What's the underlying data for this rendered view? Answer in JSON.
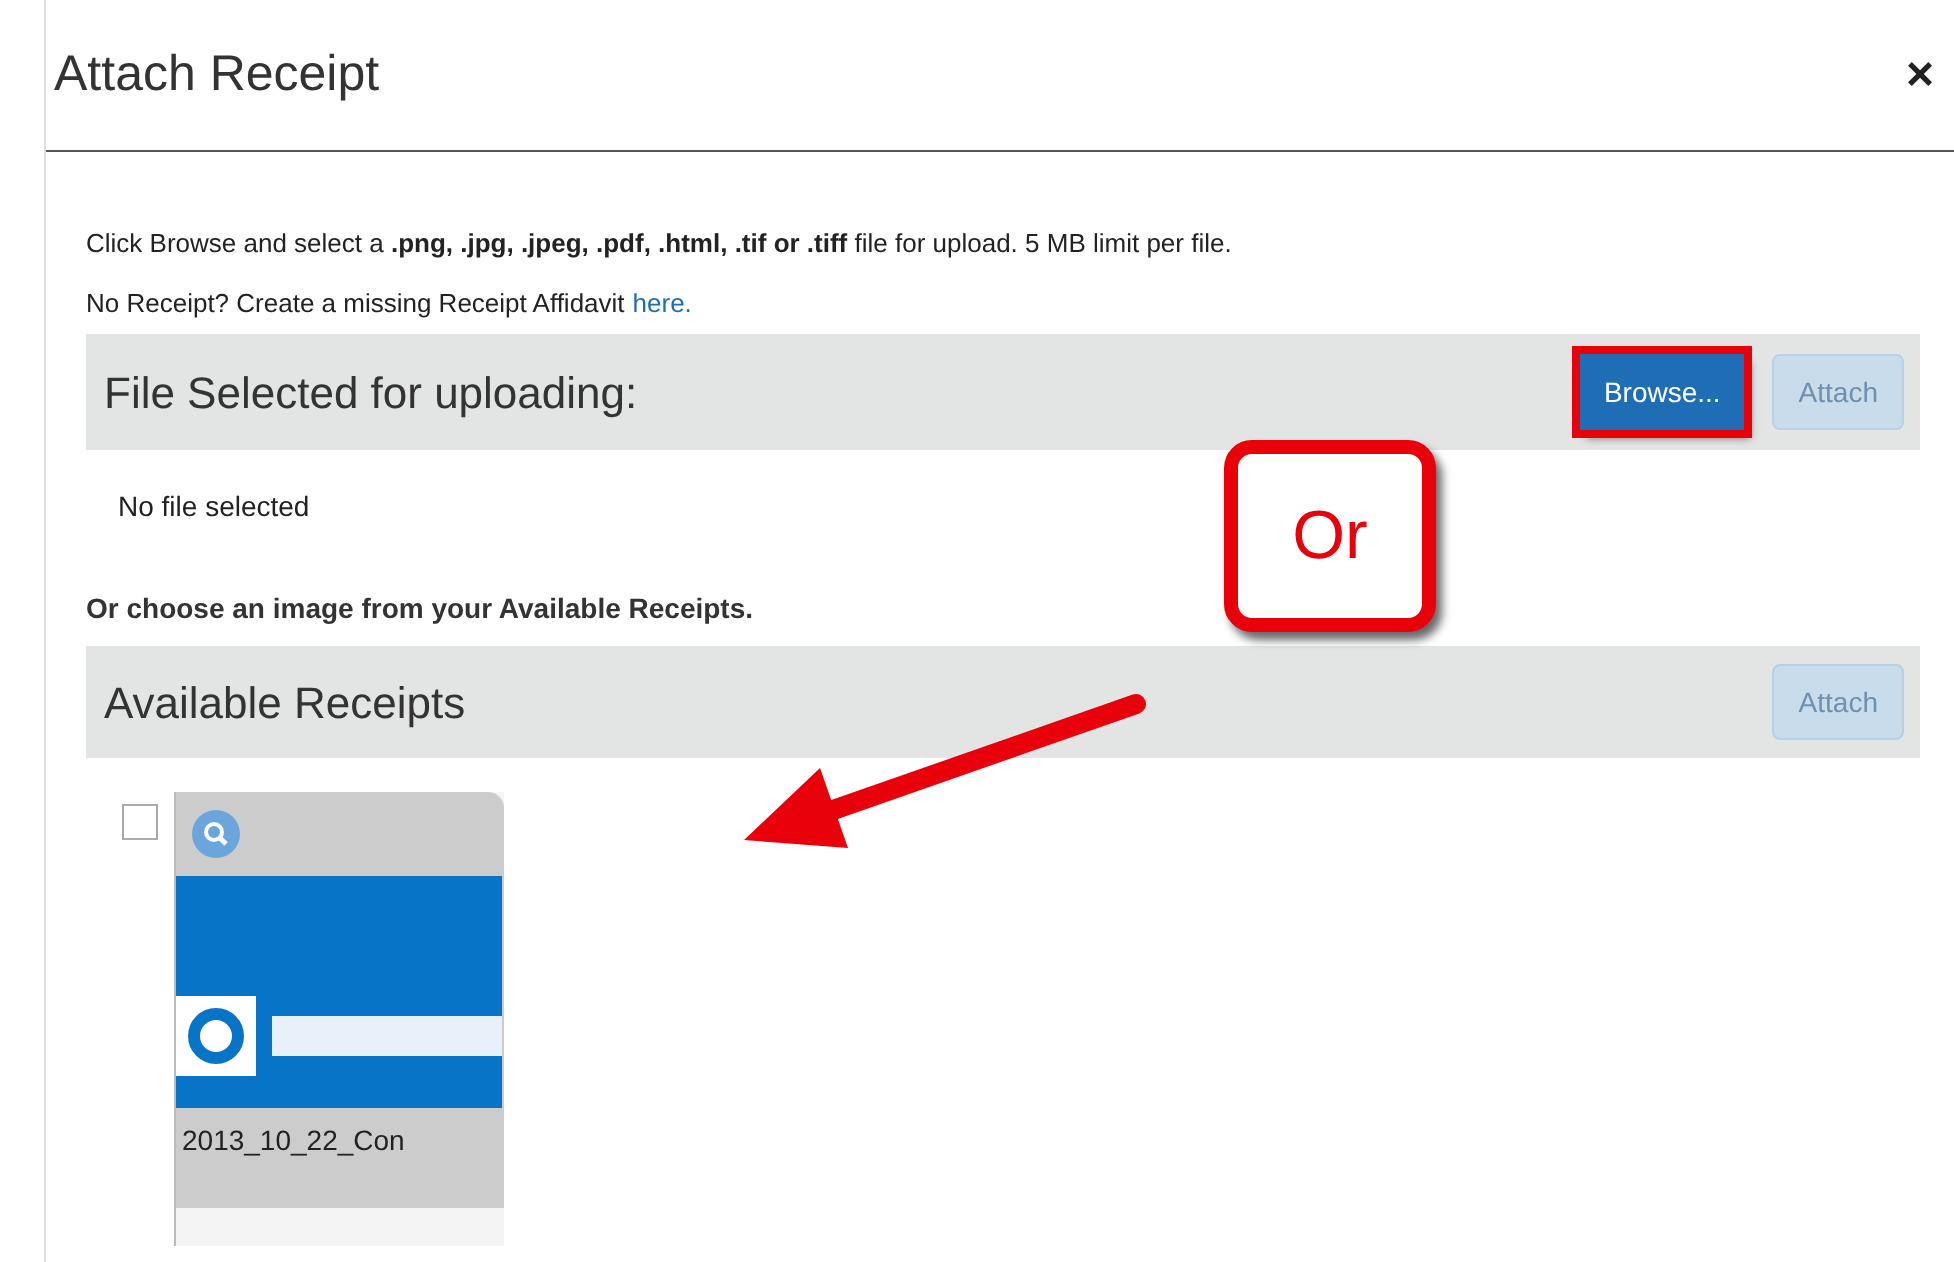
{
  "dialog": {
    "title": "Attach Receipt",
    "close": "×"
  },
  "instructions": "Click Browse and select a **.png, .jpg, .jpeg, .pdf, .html, .tif or .tiff** file for upload. 5 MB limit per file.",
  "affidavit": {
    "text": "No Receipt? Create a missing Receipt Affidavit",
    "link": "here."
  },
  "upload_section": {
    "heading": "File Selected for uploading:",
    "browse": {
      "label": "Browse...",
      "highlighted": true
    },
    "attach": {
      "label": "Attach",
      "disabled": true
    },
    "status": "No file selected"
  },
  "receipts_prompt": "Or choose an image from your Available Receipts.",
  "receipts_section": {
    "heading": "Available Receipts",
    "attach": {
      "label": "Attach",
      "disabled": true
    },
    "receipts": [
      {
        "name": "2013_10_22_Con",
        "checked": false,
        "kind": "picture"
      }
    ]
  },
  "annotations": [
    {
      "kind": "callout",
      "text": "Or"
    },
    {
      "kind": "arrow"
    }
  ]
}
